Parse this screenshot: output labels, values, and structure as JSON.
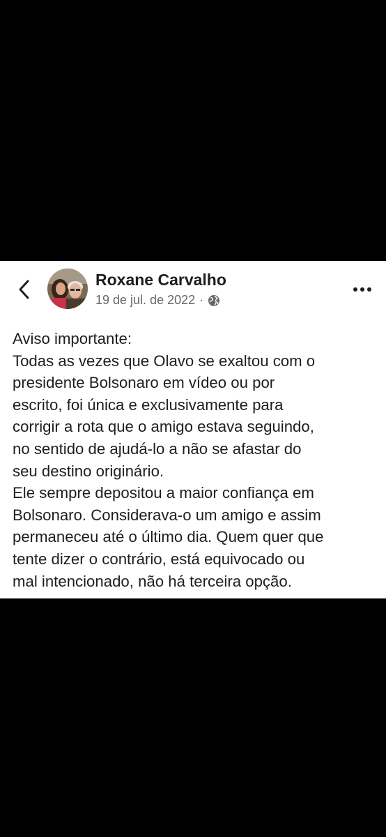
{
  "post": {
    "author_name": "Roxane Carvalho",
    "date": "19 de jul. de 2022",
    "separator": "·",
    "privacy_icon": "globe-icon",
    "lines": [
      "Aviso importante:",
      "Todas as vezes que Olavo se exaltou com o",
      "presidente Bolsonaro em vídeo ou por",
      "escrito, foi única e exclusivamente para",
      "corrigir a rota que o amigo estava seguindo,",
      "no sentido de ajudá-lo a não se afastar do",
      "seu destino originário.",
      "Ele sempre depositou a maior confiança em",
      "Bolsonaro. Considerava-o um amigo e assim",
      "permaneceu até o último dia. Quem quer que",
      "tente dizer o contrário, está equivocado ou",
      "mal intencionado, não há terceira opção."
    ]
  },
  "colors": {
    "background": "#000000",
    "card": "#ffffff",
    "text": "#1c1e21",
    "secondary_text": "#65676b"
  }
}
